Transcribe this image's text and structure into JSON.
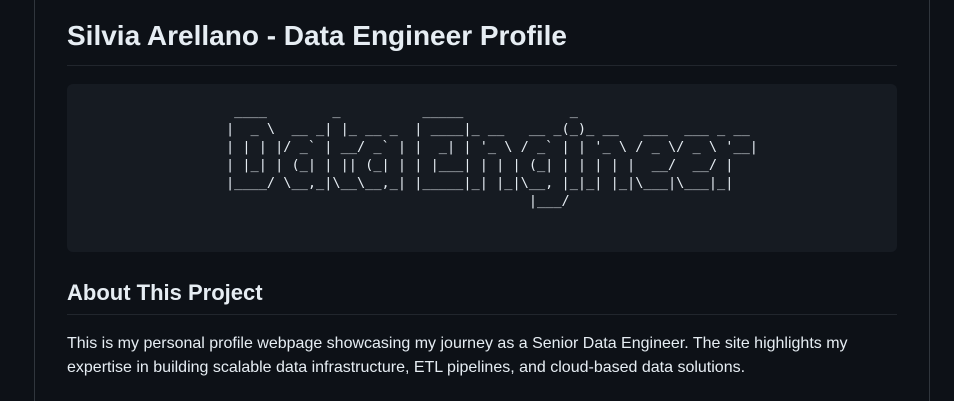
{
  "page": {
    "title": "Silvia Arellano - Data Engineer Profile",
    "ascii_banner": " ____        _          _____             _\n|  _ \\  __ _| |_ __ _  | ____|_ __   __ _(_)_ __   ___  ___ _ __\n| | | |/ _` | __/ _` | |  _| | '_ \\ / _` | | '_ \\ / _ \\/ _ \\ '__|\n| |_| | (_| | || (_| | | |___| | | | (_| | | | | |  __/  __/ |\n|____/ \\__,_|\\__\\__,_| |_____|_| |_|\\__, |_|_| |_|\\___|\\___|_|\n                                     |___/",
    "about_heading": "About This Project",
    "about_text": "This is my personal profile webpage showcasing my journey as a Senior Data Engineer. The site highlights my expertise in building scalable data infrastructure, ETL pipelines, and cloud-based data solutions."
  },
  "colors": {
    "background": "#0d1117",
    "code_background": "#161b22",
    "text": "#e6edf3",
    "divider": "#21262d"
  }
}
